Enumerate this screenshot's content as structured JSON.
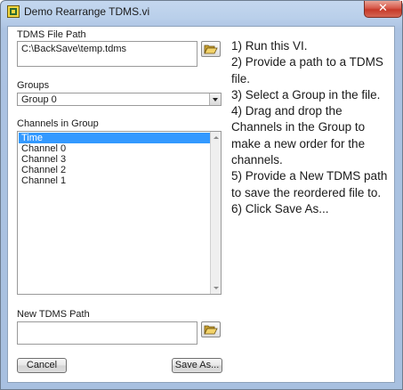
{
  "window": {
    "title": "Demo Rearrange TDMS.vi",
    "close_glyph": "✕"
  },
  "tdms_file_path": {
    "label": "TDMS File Path",
    "value": "C:\\BackSave\\temp.tdms"
  },
  "groups": {
    "label": "Groups",
    "selected": "Group 0"
  },
  "channels": {
    "label": "Channels in Group",
    "items": [
      "Time",
      "Channel 0",
      "Channel 3",
      "Channel 2",
      "Channel 1"
    ],
    "selected_index": 0
  },
  "new_tdms_path": {
    "label": "New TDMS Path",
    "value": ""
  },
  "buttons": {
    "cancel": "Cancel",
    "save_as": "Save As..."
  },
  "instructions": [
    "1) Run this VI.",
    "2) Provide a path to a TDMS",
    "file.",
    "3) Select a Group in the file.",
    "4) Drag and drop the",
    "Channels in the Group to",
    "make a new order for the",
    "channels.",
    "5) Provide a New TDMS path",
    "to save the reordered file to.",
    "6) Click Save As..."
  ],
  "colors": {
    "selection": "#3399ff",
    "close_button": "#c63a2a",
    "frame": "#a8c0e0"
  },
  "icons": {
    "app": "labview-vi-icon",
    "browse": "folder-open-icon"
  }
}
